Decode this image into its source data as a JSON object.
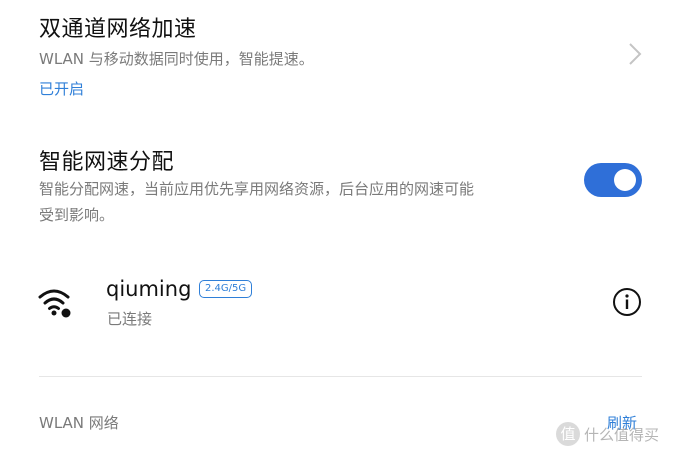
{
  "dual_channel": {
    "title": "双通道网络加速",
    "description": "WLAN 与移动数据同时使用，智能提速。",
    "status": "已开启"
  },
  "smart_speed": {
    "title": "智能网速分配",
    "description_line1": "智能分配网速，当前应用优先享用网络资源，后台应用的网速可能",
    "description_line2": "受到影响。",
    "enabled": true
  },
  "connected_network": {
    "ssid": "qiuming",
    "band": "2.4G/5G",
    "status": "已连接"
  },
  "wlan_section": {
    "label": "WLAN 网络",
    "refresh_label": "刷新"
  },
  "watermark": {
    "text": "什么值得买",
    "symbol": "值"
  },
  "colors": {
    "accent": "#2f7fd8",
    "toggle_on": "#2f6fd8",
    "secondary_text": "#7a7a7a"
  }
}
